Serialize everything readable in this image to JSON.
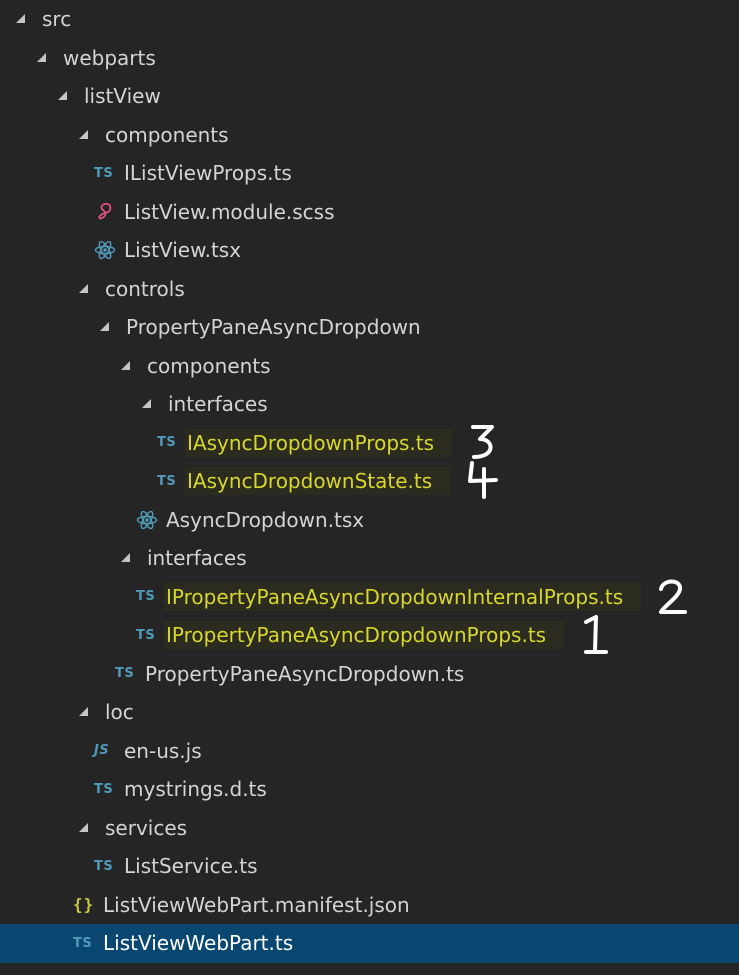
{
  "tree": [
    {
      "label": "src",
      "kind": "folder",
      "depth": 0
    },
    {
      "label": "webparts",
      "kind": "folder",
      "depth": 1
    },
    {
      "label": "listView",
      "kind": "folder",
      "depth": 2
    },
    {
      "label": "components",
      "kind": "folder",
      "depth": 3
    },
    {
      "label": "IListViewProps.ts",
      "kind": "ts",
      "depth": 4
    },
    {
      "label": "ListView.module.scss",
      "kind": "scss",
      "depth": 4
    },
    {
      "label": "ListView.tsx",
      "kind": "tsx",
      "depth": 4
    },
    {
      "label": "controls",
      "kind": "folder",
      "depth": 3
    },
    {
      "label": "PropertyPaneAsyncDropdown",
      "kind": "folder",
      "depth": 4
    },
    {
      "label": "components",
      "kind": "folder",
      "depth": 5
    },
    {
      "label": "interfaces",
      "kind": "folder",
      "depth": 6
    },
    {
      "label": "IAsyncDropdownProps.ts",
      "kind": "ts",
      "depth": 7,
      "highlight": true,
      "annotation": "3"
    },
    {
      "label": "IAsyncDropdownState.ts",
      "kind": "ts",
      "depth": 7,
      "highlight": true,
      "annotation": "4"
    },
    {
      "label": "AsyncDropdown.tsx",
      "kind": "tsx",
      "depth": 6
    },
    {
      "label": "interfaces",
      "kind": "folder",
      "depth": 5
    },
    {
      "label": "IPropertyPaneAsyncDropdownInternalProps.ts",
      "kind": "ts",
      "depth": 6,
      "highlight": true,
      "annotation": "2"
    },
    {
      "label": "IPropertyPaneAsyncDropdownProps.ts",
      "kind": "ts",
      "depth": 6,
      "highlight": true,
      "annotation": "1"
    },
    {
      "label": "PropertyPaneAsyncDropdown.ts",
      "kind": "ts",
      "depth": 5
    },
    {
      "label": "loc",
      "kind": "folder",
      "depth": 3
    },
    {
      "label": "en-us.js",
      "kind": "js",
      "depth": 4
    },
    {
      "label": "mystrings.d.ts",
      "kind": "ts",
      "depth": 4
    },
    {
      "label": "services",
      "kind": "folder",
      "depth": 3
    },
    {
      "label": "ListService.ts",
      "kind": "ts",
      "depth": 4
    },
    {
      "label": "ListViewWebPart.manifest.json",
      "kind": "json",
      "depth": 3
    },
    {
      "label": "ListViewWebPart.ts",
      "kind": "ts",
      "depth": 3,
      "selected": true
    }
  ],
  "icons": {
    "folder": "chevron-expanded-icon",
    "ts": "typescript-file-icon",
    "tsx": "react-file-icon",
    "scss": "sass-file-icon",
    "js": "javascript-file-icon",
    "json": "json-file-icon"
  },
  "icon_text": {
    "ts": "TS",
    "js": "JS",
    "json": "{}"
  },
  "colors": {
    "background": "#252526",
    "selected_row": "#094771",
    "highlight_bg": "#2b2b1f",
    "highlight_text": "#d7d72f",
    "ts_icon": "#519aba",
    "react_icon": "#519aba",
    "scss_icon": "#f55385",
    "json_icon": "#cbcb41",
    "text": "#d4d4d4"
  }
}
